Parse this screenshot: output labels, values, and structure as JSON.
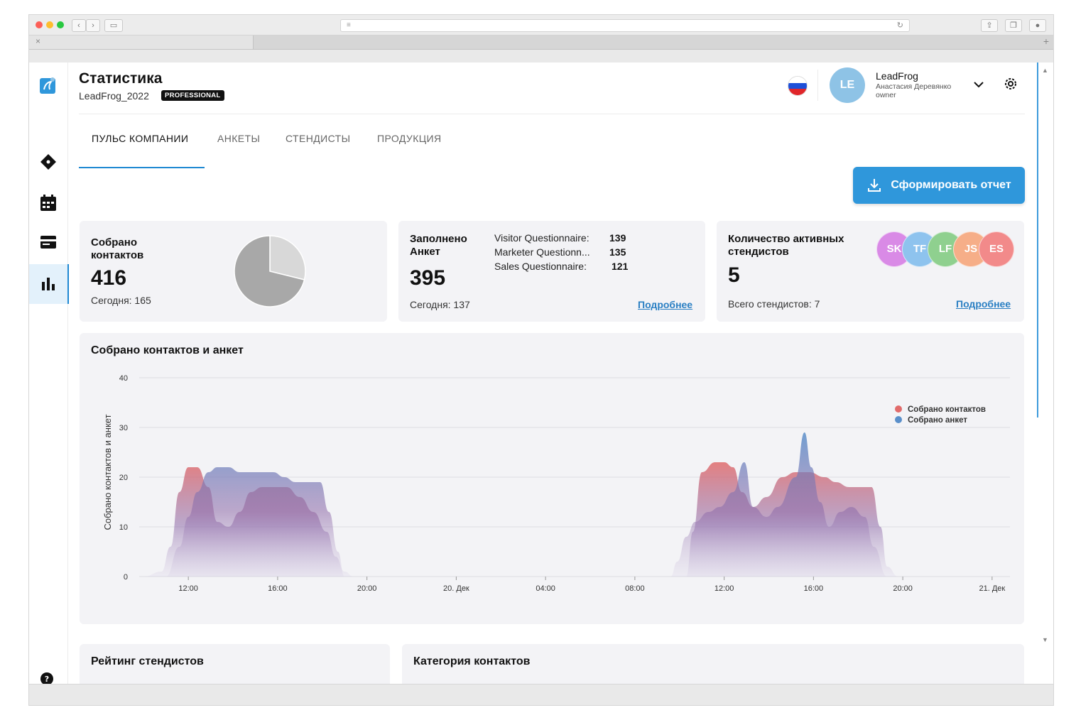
{
  "page": {
    "title": "Статистика",
    "company": "LeadFrog_2022",
    "plan": "PROFESSIONAL"
  },
  "user": {
    "initials": "LE",
    "company": "LeadFrog",
    "name": "Анастасия Деревянко",
    "role": "owner"
  },
  "tabs": [
    {
      "label": "ПУЛЬС КОМПАНИИ",
      "active": true
    },
    {
      "label": "АНКЕТЫ",
      "active": false
    },
    {
      "label": "СТЕНДИСТЫ",
      "active": false
    },
    {
      "label": "ПРОДУКЦИЯ",
      "active": false
    }
  ],
  "report_button": {
    "label": "Сформировать отчет",
    "color": "#2f97db"
  },
  "cards": {
    "contacts": {
      "label": "Собрано контактов",
      "value": "416",
      "today": "Сегодня: 165"
    },
    "surveys": {
      "label": "Заполнено Анкет",
      "value": "395",
      "today": "Сегодня: 137",
      "items": [
        {
          "name": "Visitor Questionnaire:",
          "value": "139"
        },
        {
          "name": "Marketer Questionn...",
          "value": "135"
        },
        {
          "name": "Sales Questionnaire:",
          "value": "121"
        }
      ],
      "link": "Подробнее"
    },
    "exhibitors": {
      "label": "Количество активных стендистов",
      "value": "5",
      "total": "Всего стендистов: 7",
      "link": "Подробнее",
      "avatars": [
        {
          "initials": "SK",
          "color": "#d98ae6"
        },
        {
          "initials": "TF",
          "color": "#8ec3ee"
        },
        {
          "initials": "LF",
          "color": "#8fd08f"
        },
        {
          "initials": "JS",
          "color": "#f6ae88"
        },
        {
          "initials": "ES",
          "color": "#f28a8a"
        }
      ]
    }
  },
  "pie": {
    "values": [
      120,
      296
    ],
    "colors": [
      "#d8d8d8",
      "#a8a8a8"
    ]
  },
  "chart_data": {
    "type": "area",
    "title": "Собрано контактов и анкет",
    "ylabel": "Собрано контактов и анкет",
    "ylim": [
      0,
      40
    ],
    "yticks": [
      0,
      10,
      20,
      30,
      40
    ],
    "x_range": [
      9.8,
      48.8
    ],
    "xticks": [
      {
        "x": 12,
        "label": "12:00"
      },
      {
        "x": 16,
        "label": "16:00"
      },
      {
        "x": 20,
        "label": "20:00"
      },
      {
        "x": 24,
        "label": "20. Дек"
      },
      {
        "x": 28,
        "label": "04:00"
      },
      {
        "x": 32,
        "label": "08:00"
      },
      {
        "x": 36,
        "label": "12:00"
      },
      {
        "x": 40,
        "label": "16:00"
      },
      {
        "x": 44,
        "label": "20:00"
      },
      {
        "x": 48,
        "label": "21. Дек"
      },
      {
        "x": 52,
        "label": "04:00"
      },
      {
        "x": 56,
        "label": "08:00"
      }
    ],
    "legend_position": "top-right",
    "series": [
      {
        "name": "Собрано контактов",
        "color": "#e16b6b",
        "x": [
          10.0,
          10.8,
          11.2,
          11.6,
          12.0,
          12.4,
          12.9,
          13.3,
          13.8,
          14.3,
          14.8,
          15.3,
          15.8,
          16.4,
          17.0,
          17.6,
          18.2,
          18.6,
          19.0,
          19.4,
          34.3,
          34.6,
          35.0,
          35.6,
          36.0,
          36.4,
          36.8,
          37.3,
          37.9,
          38.6,
          39.2,
          39.8,
          40.5,
          41.0,
          41.6,
          42.1,
          42.6,
          43.0,
          43.3,
          43.8,
          59.3,
          59.5,
          59.9,
          60.3
        ],
        "y": [
          0,
          1,
          6,
          17,
          22,
          22,
          18,
          11,
          10,
          13,
          17,
          18,
          18,
          18,
          16,
          13,
          9,
          4,
          1,
          0,
          0,
          9,
          21,
          23,
          23,
          22,
          17,
          14,
          16,
          20,
          21,
          21,
          20,
          19,
          18,
          18,
          18,
          10,
          2,
          0,
          0,
          6,
          13,
          18
        ]
      },
      {
        "name": "Собрано анкет",
        "color": "#5a8fca",
        "x": [
          11.0,
          11.6,
          12.0,
          12.4,
          12.9,
          13.3,
          13.8,
          14.3,
          14.8,
          15.3,
          15.8,
          16.3,
          16.8,
          17.4,
          17.9,
          18.3,
          18.7,
          19.0,
          33.6,
          33.9,
          34.3,
          34.7,
          35.3,
          35.8,
          36.4,
          36.9,
          37.3,
          37.9,
          38.4,
          39.2,
          39.6,
          39.9,
          40.3,
          40.7,
          41.2,
          41.7,
          42.3,
          42.7,
          43.3,
          58.8,
          59.3,
          59.9,
          60.3
        ],
        "y": [
          0,
          6,
          12,
          17,
          21,
          22,
          22,
          21,
          21,
          21,
          21,
          20,
          19,
          19,
          19,
          13,
          5,
          0,
          0,
          3,
          8,
          11,
          13,
          14,
          17,
          23,
          14,
          12,
          14,
          20,
          29,
          22,
          15,
          10,
          13,
          14,
          12,
          6,
          0,
          0,
          3,
          9,
          13
        ]
      }
    ]
  },
  "bottom_cards": {
    "rating": "Рейтинг стендистов",
    "categories": "Категория контактов"
  }
}
